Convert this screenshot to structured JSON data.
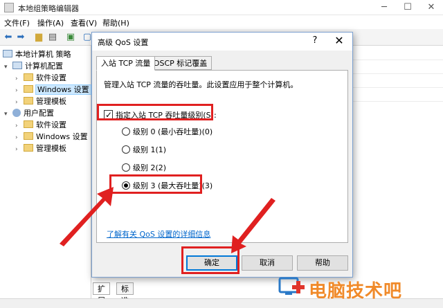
{
  "window": {
    "title": "本地组策略编辑器",
    "min_glyph": "─",
    "max_glyph": "☐",
    "close_glyph": "✕"
  },
  "menu": [
    "文件(F)",
    "操作(A)",
    "查看(V)",
    "帮助(H)"
  ],
  "toolbar_icons": [
    "back-arrow-icon",
    "forward-arrow-icon",
    "folder-up-icon",
    "show-hide-tree-icon",
    "export-list-icon",
    "properties-icon"
  ],
  "tree": {
    "root": "本地计算机 策略",
    "computer": "计算机配置",
    "computer_children": [
      "软件设置",
      "Windows 设置",
      "管理模板"
    ],
    "user": "用户配置",
    "user_children": [
      "软件设置",
      "Windows 设置",
      "管理模板"
    ]
  },
  "bottom_tabs": [
    "扩展",
    "标准"
  ],
  "dialog": {
    "title": "高级 QoS 设置",
    "help_glyph": "?",
    "close_glyph": "✕",
    "tabs": [
      "入站 TCP 流量",
      "DSCP 标记覆盖"
    ],
    "description": "管理入站 TCP 流量的吞吐量。此设置应用于整个计算机。",
    "checkbox_label": "指定入站 TCP 吞吐量级别(S):",
    "checkbox_checked": true,
    "radios": [
      {
        "label": "级别 0 (最小吞吐量)(0)",
        "selected": false
      },
      {
        "label": "级别 1(1)",
        "selected": false
      },
      {
        "label": "级别 2(2)",
        "selected": false
      },
      {
        "label": "级别 3 (最大吞吐量)(3)",
        "selected": true
      }
    ],
    "link": "了解有关 QoS 设置的详细信息",
    "buttons": {
      "ok": "确定",
      "cancel": "取消",
      "help": "帮助"
    }
  },
  "watermark": {
    "text": "电脑技术吧"
  },
  "colors": {
    "annotation_red": "#e02020",
    "watermark_orange": "#f08a2a",
    "link_blue": "#0066cc",
    "selection": "#cce8ff"
  }
}
